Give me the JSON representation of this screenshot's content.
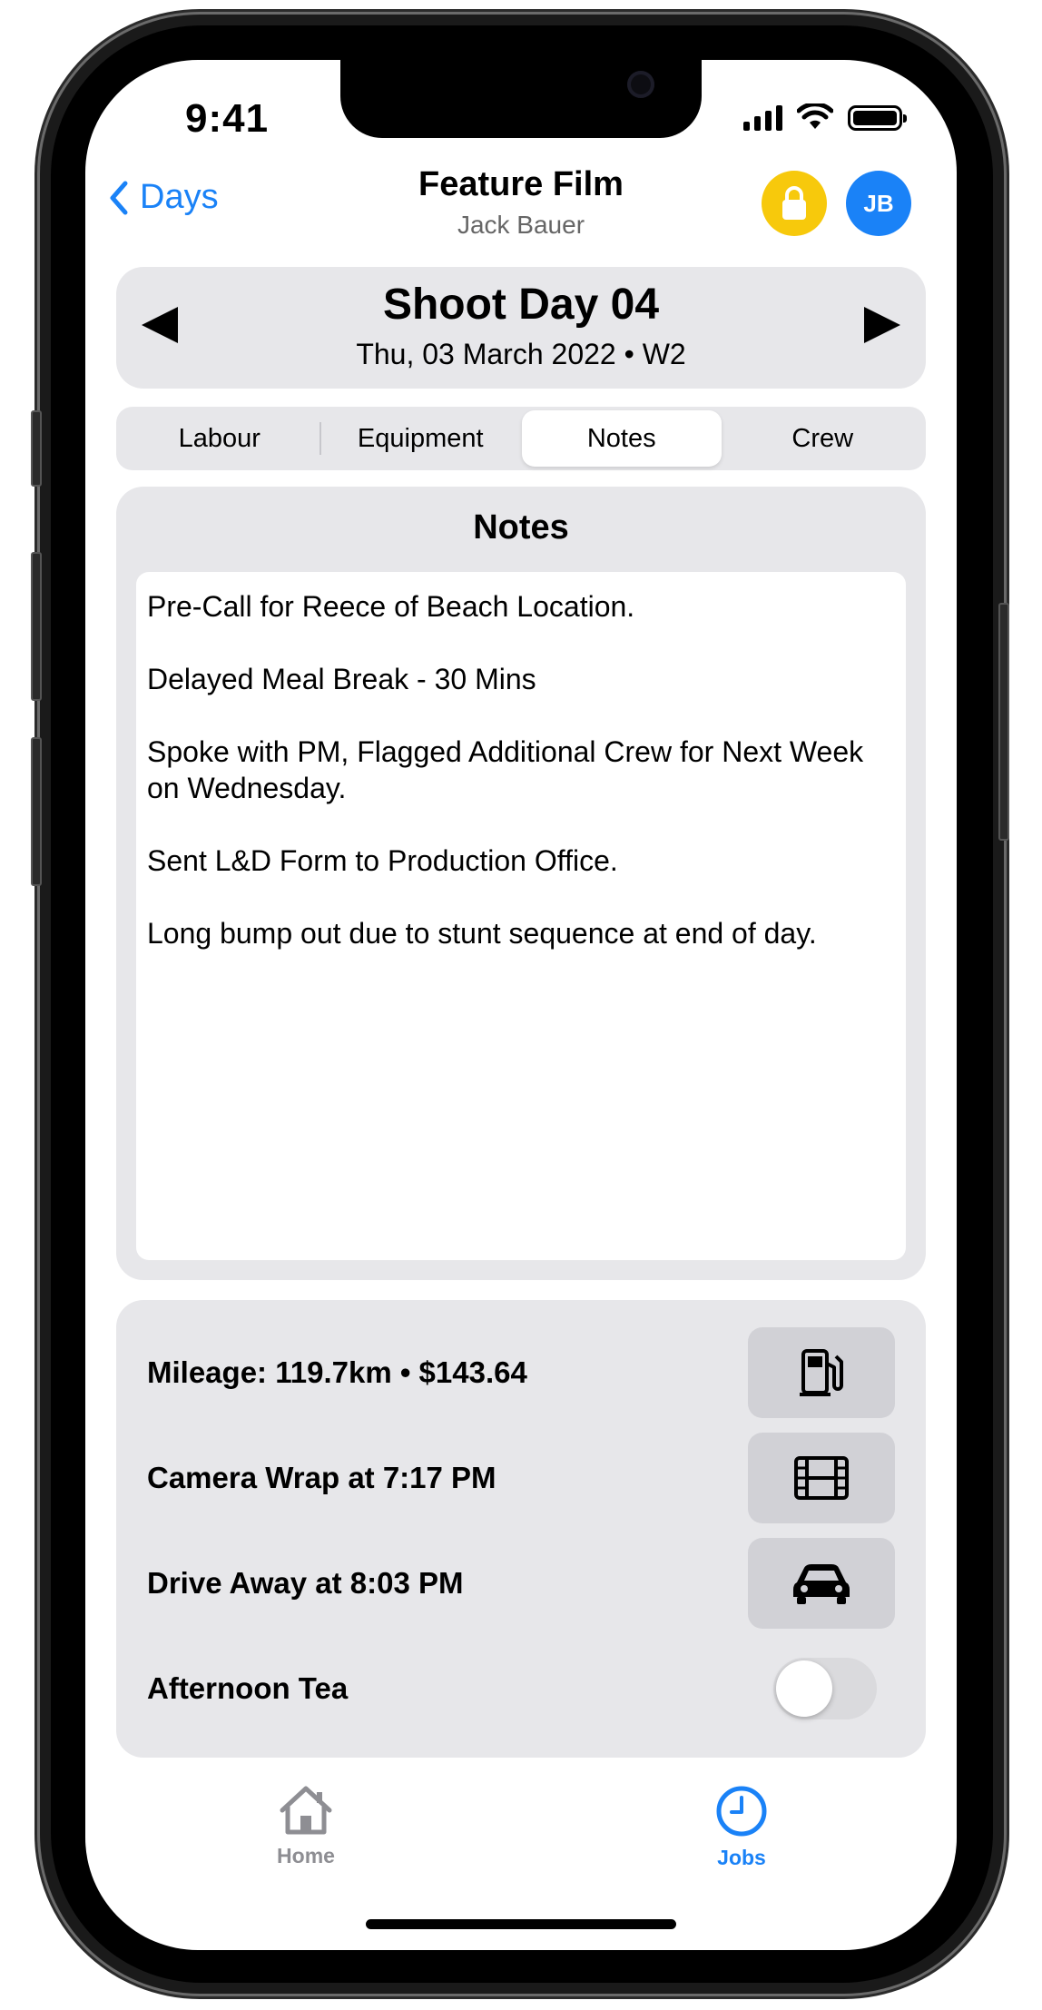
{
  "status_bar": {
    "time": "9:41"
  },
  "nav": {
    "back_label": "Days",
    "title": "Feature Film",
    "subtitle": "Jack Bauer",
    "avatar_initials": "JB"
  },
  "day": {
    "title": "Shoot Day 04",
    "subtitle": "Thu, 03 March 2022 • W2"
  },
  "tabs": [
    {
      "label": "Labour",
      "selected": false
    },
    {
      "label": "Equipment",
      "selected": false
    },
    {
      "label": "Notes",
      "selected": true
    },
    {
      "label": "Crew",
      "selected": false
    }
  ],
  "notes": {
    "heading": "Notes",
    "lines": [
      "Pre-Call for Reece of Beach Location.",
      "Delayed Meal Break - 30 Mins",
      "Spoke with PM, Flagged Additional Crew for Next Week on Wednesday.",
      "Sent L&D Form to Production Office.",
      "Long bump out due to stunt sequence at end of day."
    ]
  },
  "info": {
    "mileage": "Mileage: 119.7km • $143.64",
    "camera_wrap": "Camera Wrap at 7:17 PM",
    "drive_away": "Drive Away at 8:03 PM",
    "afternoon_tea": "Afternoon Tea",
    "afternoon_tea_on": false,
    "icons": [
      "fuel-pump-icon",
      "film-icon",
      "car-icon"
    ]
  },
  "tab_bar": {
    "items": [
      {
        "label": "Home",
        "icon": "house-icon",
        "selected": false
      },
      {
        "label": "Jobs",
        "icon": "clock-icon",
        "selected": true
      }
    ]
  },
  "colors": {
    "accent": "#1a82f7",
    "lock_yellow": "#f7c90c",
    "card_gray": "#e7e7ea",
    "inactive_tab": "#8e8e93"
  }
}
